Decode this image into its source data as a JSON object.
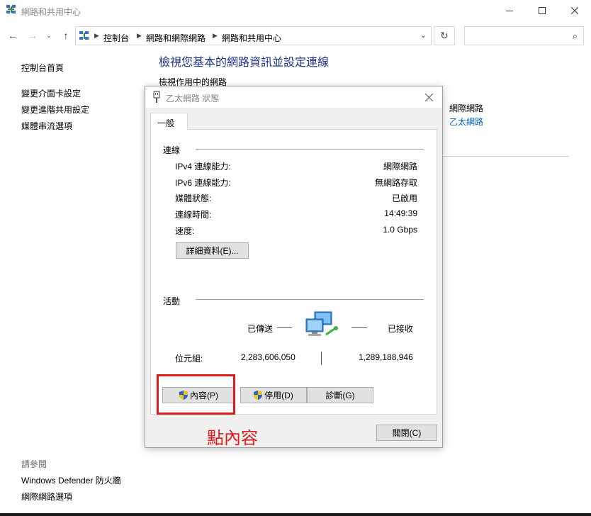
{
  "window": {
    "title": "網路和共用中心"
  },
  "address_bar": {
    "crumbs": [
      "控制台",
      "網路和網際網路",
      "網路和共用中心"
    ],
    "search_placeholder": ""
  },
  "left_pane": {
    "home": "控制台首頁",
    "links": [
      "變更介面卡設定",
      "變更進階共用設定",
      "媒體串流選項"
    ],
    "see_also_title": "請參閱",
    "see_also": [
      "Windows Defender 防火牆",
      "網際網路選項"
    ]
  },
  "main": {
    "title": "檢視您基本的網路資訊並設定連線",
    "active_networks_label": "檢視作用中的網路",
    "access_type_value": "網際網路",
    "connection_link": "乙太網路"
  },
  "dialog": {
    "title": "乙太網路 狀態",
    "tab": "一般",
    "connection_group": "連線",
    "rows": [
      {
        "label": "IPv4 連線能力:",
        "value": "網際網路"
      },
      {
        "label": "IPv6 連線能力:",
        "value": "無網路存取"
      },
      {
        "label": "媒體狀態:",
        "value": "已啟用"
      },
      {
        "label": "連線時間:",
        "value": "14:49:39"
      },
      {
        "label": "速度:",
        "value": "1.0 Gbps"
      }
    ],
    "details_button": "詳細資料(E)...",
    "activity_group": "活動",
    "sent_label": "已傳送",
    "received_label": "已接收",
    "bytes_label": "位元組:",
    "bytes_sent": "2,283,606,050",
    "bytes_received": "1,289,188,946",
    "properties_button": "內容(P)",
    "disable_button": "停用(D)",
    "diagnose_button": "診斷(G)",
    "close_button": "關閉(C)"
  },
  "annotation": {
    "text": "點內容",
    "color": "#e01b1b"
  },
  "colors": {
    "title_blue": "#1e3287",
    "link_blue": "#0066cc"
  }
}
